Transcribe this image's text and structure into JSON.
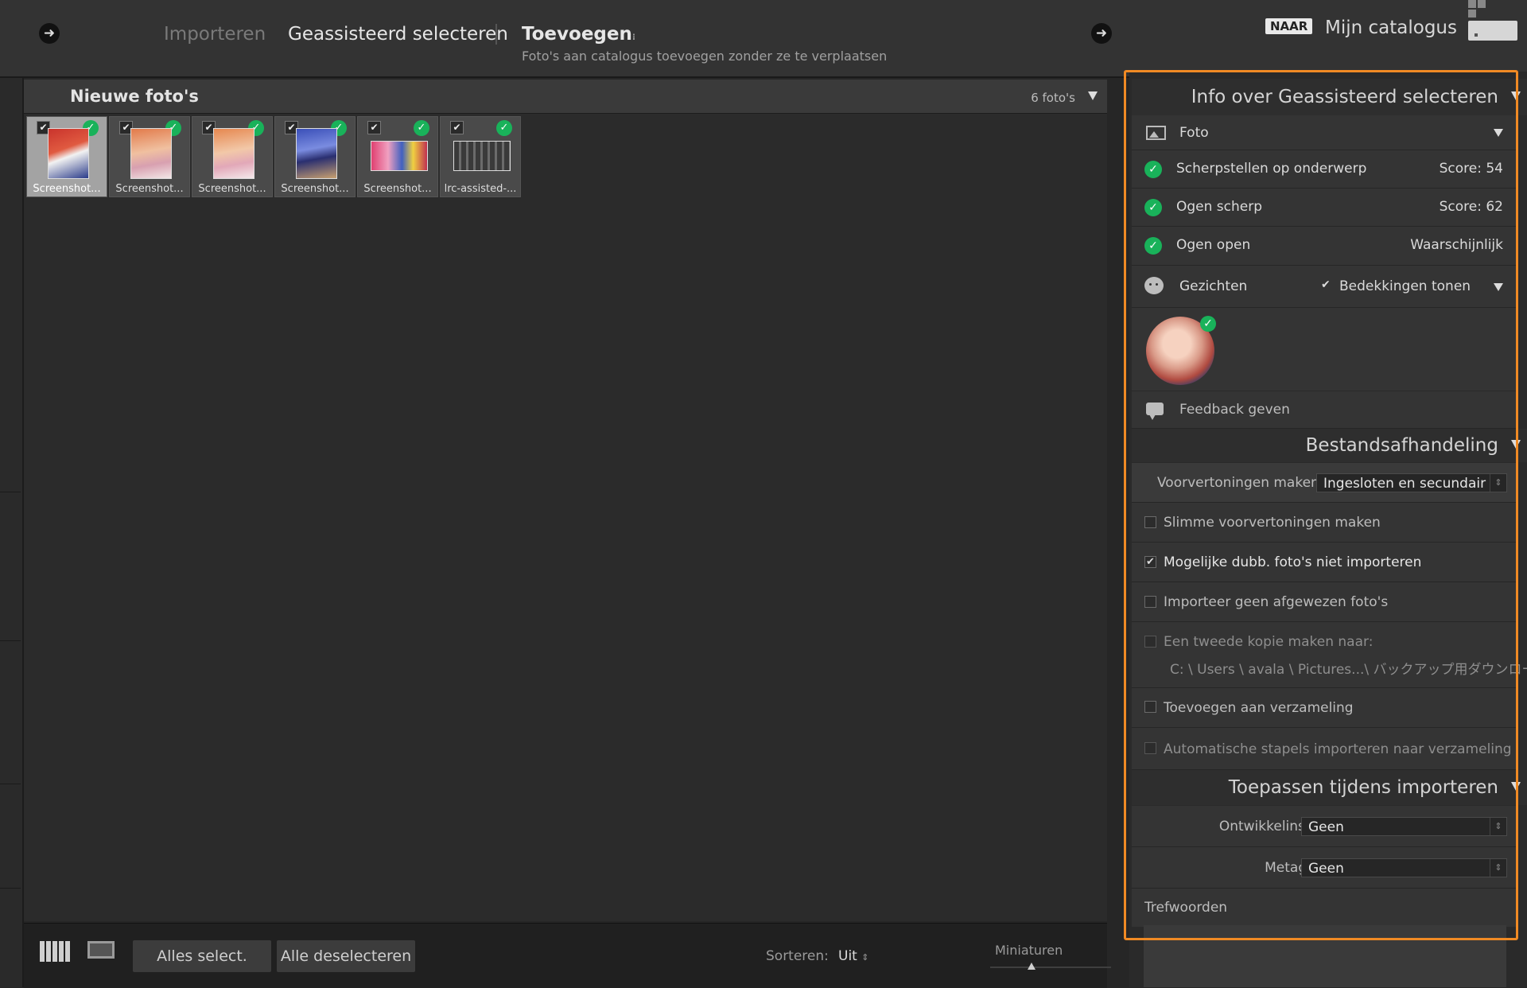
{
  "topbar": {
    "tabs": [
      "Importeren",
      "Geassisteerd selecteren",
      "Toevoegen"
    ],
    "subtitle": "Foto's aan catalogus toevoegen zonder ze te verplaatsen",
    "naar_badge": "NAAR",
    "catalog_name": "Mijn catalogus"
  },
  "grid": {
    "title": "Nieuwe foto's",
    "count": "6 foto's",
    "thumbnails": [
      {
        "caption": "Screenshot...",
        "checked": true,
        "selected": true
      },
      {
        "caption": "Screenshot...",
        "checked": true,
        "selected": false
      },
      {
        "caption": "Screenshot...",
        "checked": true,
        "selected": false
      },
      {
        "caption": "Screenshot...",
        "checked": true,
        "selected": false
      },
      {
        "caption": "Screenshot...",
        "checked": true,
        "selected": false
      },
      {
        "caption": "lrc-assisted-...",
        "checked": true,
        "selected": false
      }
    ]
  },
  "bottombar": {
    "select_all": "Alles select.",
    "deselect_all": "Alle deselecteren",
    "sort_label": "Sorteren:",
    "sort_value": "Uit",
    "thumbs_label": "Miniaturen",
    "thumbnail_size": 0.34
  },
  "assist": {
    "title": "Info over Geassisteerd selecteren",
    "foto_label": "Foto",
    "rows": [
      {
        "label": "Scherpstellen op onderwerp",
        "value": "Score: 54"
      },
      {
        "label": "Ogen scherp",
        "value": "Score: 62"
      },
      {
        "label": "Ogen open",
        "value": "Waarschijnlijk"
      }
    ],
    "faces_label": "Gezichten",
    "show_masks_label": "Bedekkingen tonen",
    "feedback_label": "Feedback geven"
  },
  "file_handling": {
    "title": "Bestandsafhandeling",
    "previews_label": "Voorvertoningen maken",
    "previews_value": "Ingesloten en secundair",
    "options": [
      {
        "label": "Slimme voorvertoningen maken",
        "checked": false
      },
      {
        "label": "Mogelijke dubb. foto's niet importeren",
        "checked": true
      },
      {
        "label": "Importeer geen afgewezen foto's",
        "checked": false
      }
    ],
    "second_copy_label": "Een tweede kopie maken naar:",
    "second_copy_path": "C: \\ Users \\ avala \\ Pictures...\\ バックアップ用ダウンロード",
    "add_collection_label": "Toevoegen aan verzameling",
    "auto_stacks_label": "Automatische stapels importeren naar verzameling"
  },
  "apply": {
    "title": "Toepassen tijdens importeren",
    "develop_label": "Ontwikkelinstellingen",
    "develop_value": "Geen",
    "metadata_label": "Metagegevens",
    "metadata_value": "Geen",
    "keywords_label": "Trefwoorden"
  },
  "colors": {
    "accent_orange": "#f08a24",
    "ok_green": "#19b25a"
  }
}
